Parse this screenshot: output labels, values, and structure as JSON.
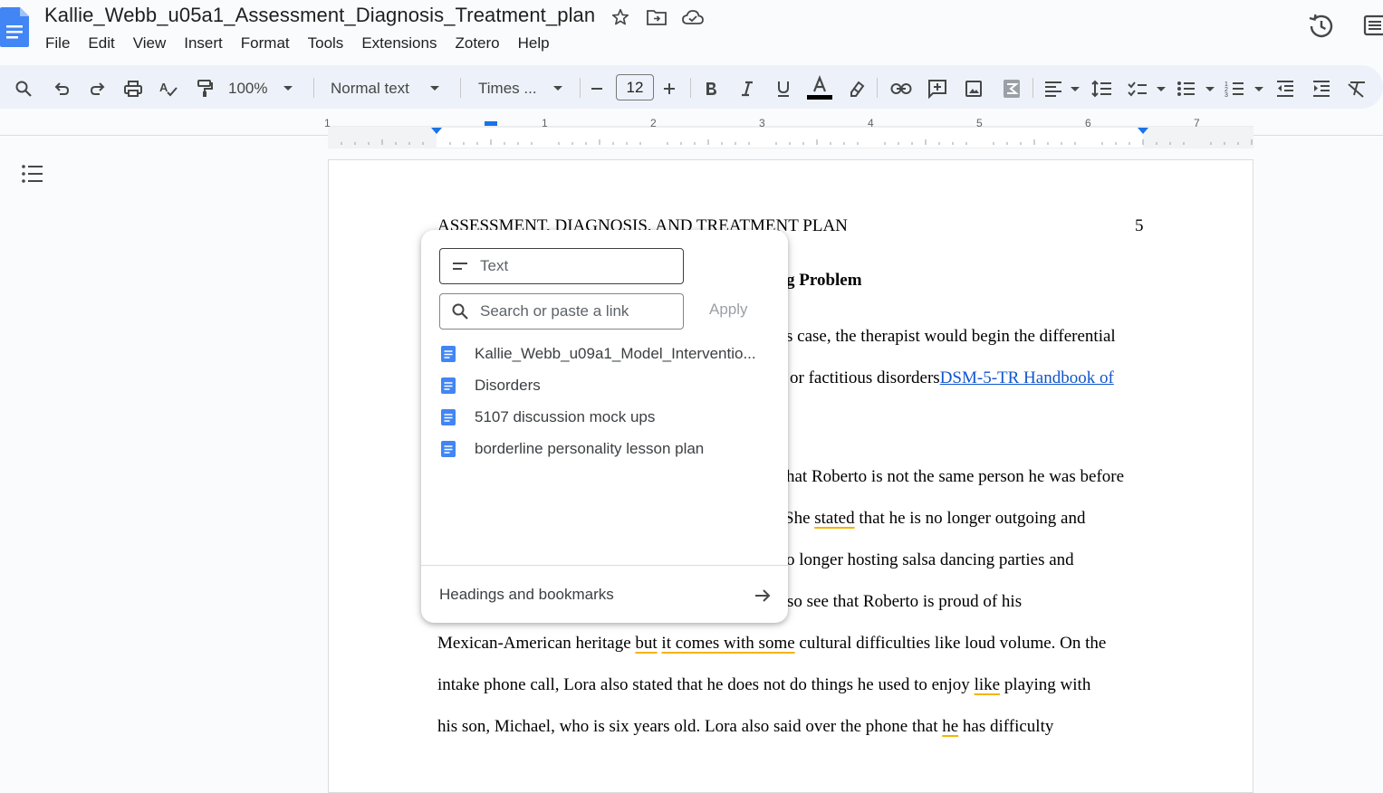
{
  "app": {
    "title": "Kallie_Webb_u05a1_Assessment_Diagnosis_Treatment_plan",
    "menus": [
      "File",
      "Edit",
      "View",
      "Insert",
      "Format",
      "Tools",
      "Extensions",
      "Zotero",
      "Help"
    ]
  },
  "toolbar": {
    "zoom": "100%",
    "style": "Normal text",
    "font": "Times ...",
    "font_size": "12",
    "text_color": "#000000"
  },
  "ruler": {
    "numbers": [
      "1",
      "1",
      "2",
      "3",
      "4",
      "5",
      "6",
      "7"
    ]
  },
  "document": {
    "header_title": "ASSESSMENT, DIAGNOSIS, AND TREATMENT PLAN",
    "page_number": "5",
    "heading_fragment": "g Problem",
    "lines": {
      "l1": "s case, the therapist would begin the differential",
      "l2": "or factitious disorders",
      "l2_link": "DSM-5-TR Handbook of",
      "l3": "hat Roberto is not the same person he was before",
      "l4_a": "She ",
      "l4_b": "stated",
      "l4_c": " that he is no longer outgoing and",
      "l5": "o longer hosting salsa dancing parties and",
      "l6": "so see that Roberto is proud of his",
      "l7_a": "Mexican-American heritage ",
      "l7_b": "but",
      "l7_c": " ",
      "l7_d": "it comes with some",
      "l7_e": " cultural difficulties like loud volume. On the",
      "l8_a": "intake phone call, Lora also stated that he does not do things he used to enjoy ",
      "l8_b": "like",
      "l8_c": " playing with",
      "l9_a": "his son, Michael, who is six years old. Lora also said over the phone that ",
      "l9_b": "he",
      "l9_c": " has difficulty"
    }
  },
  "link_popup": {
    "text_placeholder": "Text",
    "search_placeholder": "Search or paste a link",
    "apply_label": "Apply",
    "suggestions": [
      "Kallie_Webb_u09a1_Model_Interventio...",
      "Disorders",
      "5107 discussion mock ups",
      "borderline personality lesson plan"
    ],
    "footer_label": "Headings and bookmarks"
  },
  "colors": {
    "accent_blue": "#4285f4",
    "link": "#1155cc",
    "spell_underline": "#f4b400"
  }
}
